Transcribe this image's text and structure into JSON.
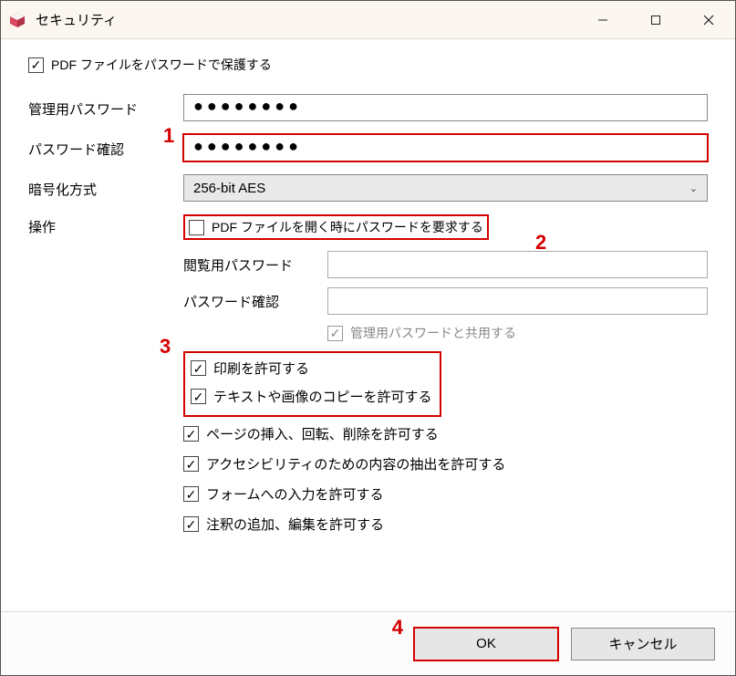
{
  "window": {
    "title": "セキュリティ"
  },
  "protect": {
    "label": "PDF ファイルをパスワードで保護する",
    "checked": true
  },
  "fields": {
    "admin_pw_label": "管理用パスワード",
    "admin_pw_value": "●●●●●●●●",
    "confirm_pw_label": "パスワード確認",
    "confirm_pw_value": "●●●●●●●●",
    "encryption_label": "暗号化方式",
    "encryption_value": "256-bit AES",
    "ops_label": "操作"
  },
  "ops": {
    "require_open_pw": {
      "label": "PDF ファイルを開く時にパスワードを要求する",
      "checked": false
    },
    "view_pw_label": "閲覧用パスワード",
    "view_pw_confirm_label": "パスワード確認",
    "share_admin_pw": {
      "label": "管理用パスワードと共用する",
      "checked": true
    },
    "allow_print": {
      "label": "印刷を許可する",
      "checked": true
    },
    "allow_copy": {
      "label": "テキストや画像のコピーを許可する",
      "checked": true
    },
    "allow_page_ops": {
      "label": "ページの挿入、回転、削除を許可する",
      "checked": true
    },
    "allow_accessibility": {
      "label": "アクセシビリティのための内容の抽出を許可する",
      "checked": true
    },
    "allow_form": {
      "label": "フォームへの入力を許可する",
      "checked": true
    },
    "allow_annot": {
      "label": "注釈の追加、編集を許可する",
      "checked": true
    }
  },
  "buttons": {
    "ok": "OK",
    "cancel": "キャンセル"
  },
  "annotations": {
    "n1": "1",
    "n2": "2",
    "n3": "3",
    "n4": "4"
  }
}
